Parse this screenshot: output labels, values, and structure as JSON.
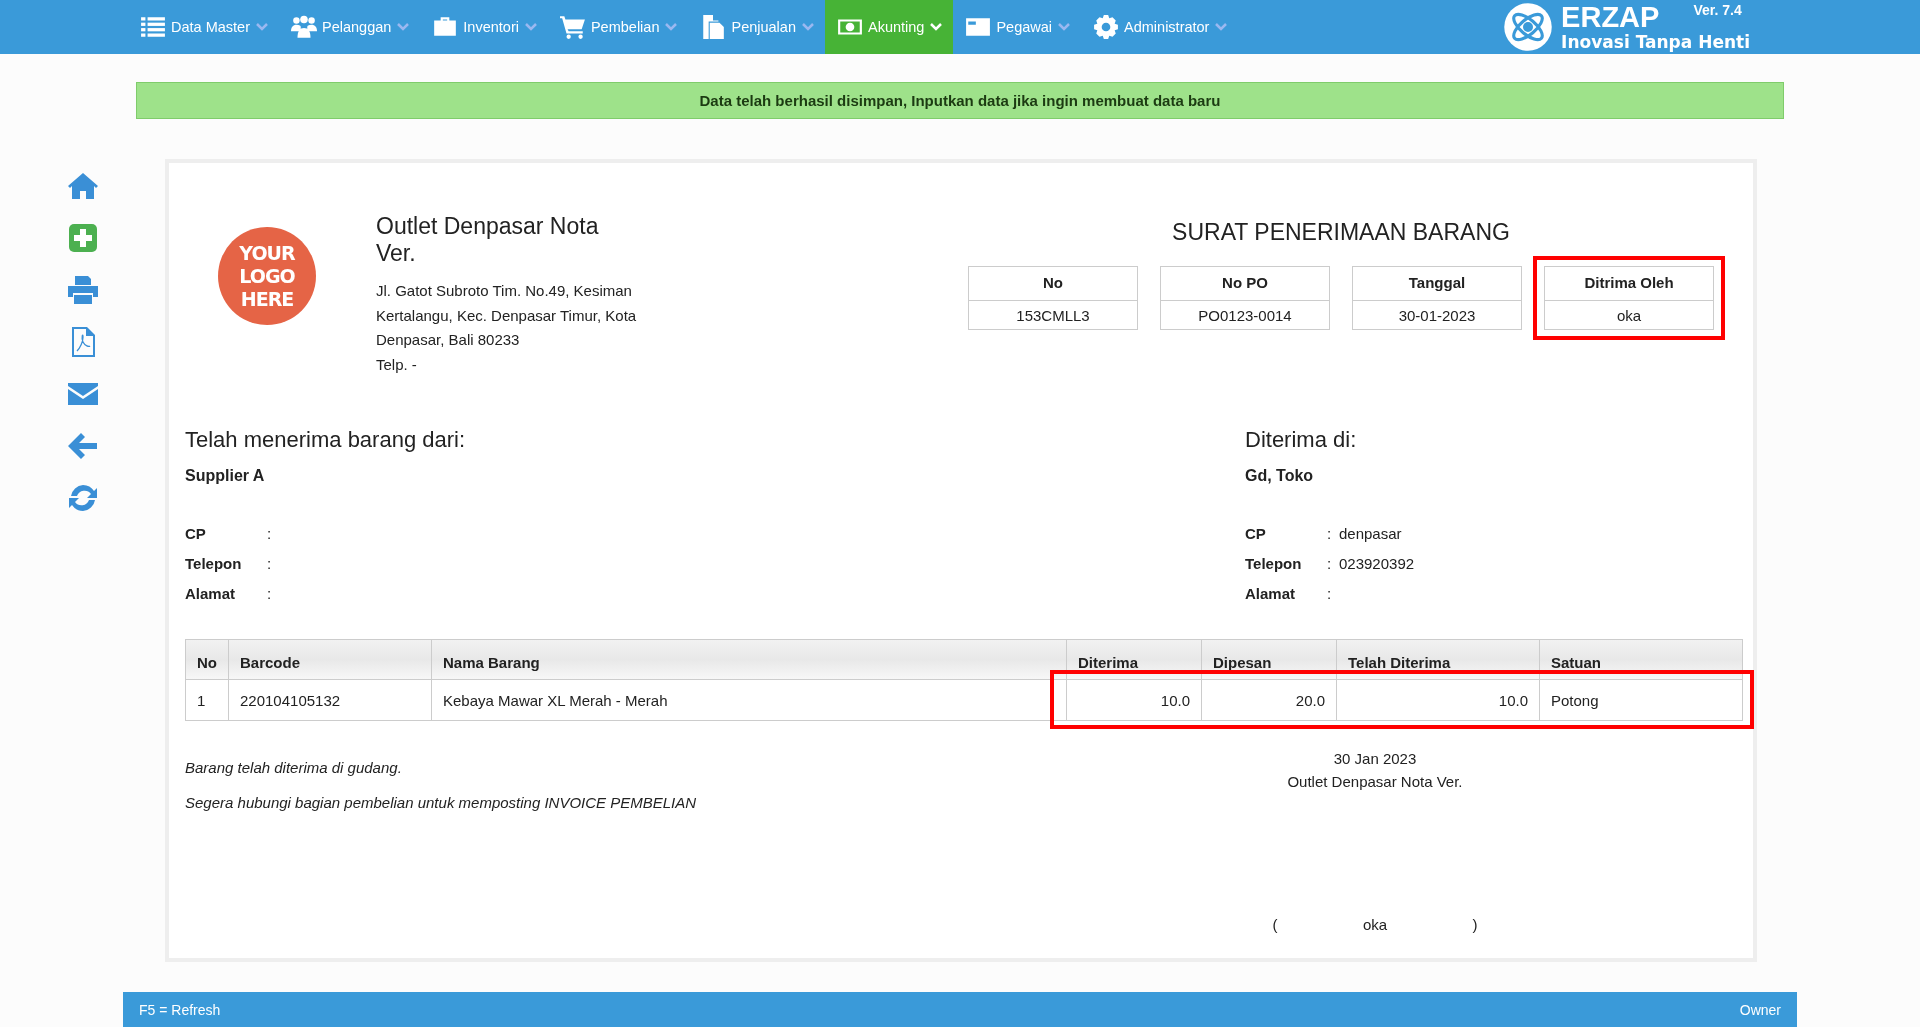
{
  "nav": {
    "items": [
      {
        "label": "Data Master",
        "selected": false
      },
      {
        "label": "Pelanggan",
        "selected": false
      },
      {
        "label": "Inventori",
        "selected": false
      },
      {
        "label": "Pembelian",
        "selected": false
      },
      {
        "label": "Penjualan",
        "selected": false
      },
      {
        "label": "Akunting",
        "selected": true
      },
      {
        "label": "Pegawai",
        "selected": false
      },
      {
        "label": "Administrator",
        "selected": false
      }
    ],
    "brand": {
      "name": "ERZAP",
      "version": "Ver. 7.4",
      "tagline": "Inovasi Tanpa Henti"
    }
  },
  "alert": "Data telah berhasil disimpan, Inputkan data jika ingin membuat data baru",
  "document": {
    "logo": "YOUR LOGO HERE",
    "company": "Outlet Denpasar Nota Ver.",
    "address": [
      "Jl. Gatot Subroto Tim. No.49, Kesiman Kertalangu, Kec. Denpasar Timur, Kota Denpasar, Bali 80233",
      "Telp. -"
    ],
    "title": "SURAT PENERIMAAN BARANG",
    "info_boxes": [
      {
        "label": "No",
        "value": "153CMLL3",
        "highlighted": false
      },
      {
        "label": "No PO",
        "value": "PO0123-0014",
        "highlighted": false
      },
      {
        "label": "Tanggal",
        "value": "30-01-2023",
        "highlighted": false
      },
      {
        "label": "Ditrima Oleh",
        "value": "oka",
        "highlighted": true
      }
    ],
    "from": {
      "heading": "Telah menerima barang dari:",
      "name": "Supplier A",
      "fields": [
        {
          "label": "CP",
          "separator": ":"
        },
        {
          "label": "Telepon",
          "separator": ":"
        },
        {
          "label": "Alamat",
          "separator": ":"
        }
      ]
    },
    "to": {
      "heading": "Diterima di:",
      "name": "Gd, Toko",
      "fields": [
        {
          "label": "CP",
          "separator": ":",
          "value": "denpasar"
        },
        {
          "label": "Telepon",
          "separator": ":",
          "value": "023920392"
        },
        {
          "label": "Alamat",
          "separator": ":"
        }
      ]
    },
    "table": {
      "columns": [
        {
          "label": "No",
          "kind": "text",
          "highlighted": false
        },
        {
          "label": "Barcode",
          "kind": "text",
          "highlighted": false
        },
        {
          "label": "Nama Barang",
          "kind": "text",
          "highlighted": false
        },
        {
          "label": "Diterima",
          "kind": "number",
          "highlighted": true
        },
        {
          "label": "Dipesan",
          "kind": "number",
          "highlighted": true
        },
        {
          "label": "Telah Diterima",
          "kind": "number",
          "highlighted": true
        },
        {
          "label": "Satuan",
          "kind": "text",
          "highlighted": true
        }
      ],
      "rows": [
        [
          "1",
          "220104105132",
          "Kebaya Mawar XL Merah - Merah",
          "10.0",
          "20.0",
          "10.0",
          "Potong"
        ]
      ]
    },
    "notes": [
      "Barang telah diterima di gudang.",
      "Segera hubungi bagian pembelian untuk memposting INVOICE PEMBELIAN"
    ],
    "date": "30 Jan 2023",
    "signer_company": "Outlet Denpasar Nota Ver.",
    "signature": {
      "open": "(",
      "name": "oka",
      "close": ")"
    }
  },
  "status_bar": {
    "left": "F5 = Refresh",
    "right": "Owner"
  }
}
